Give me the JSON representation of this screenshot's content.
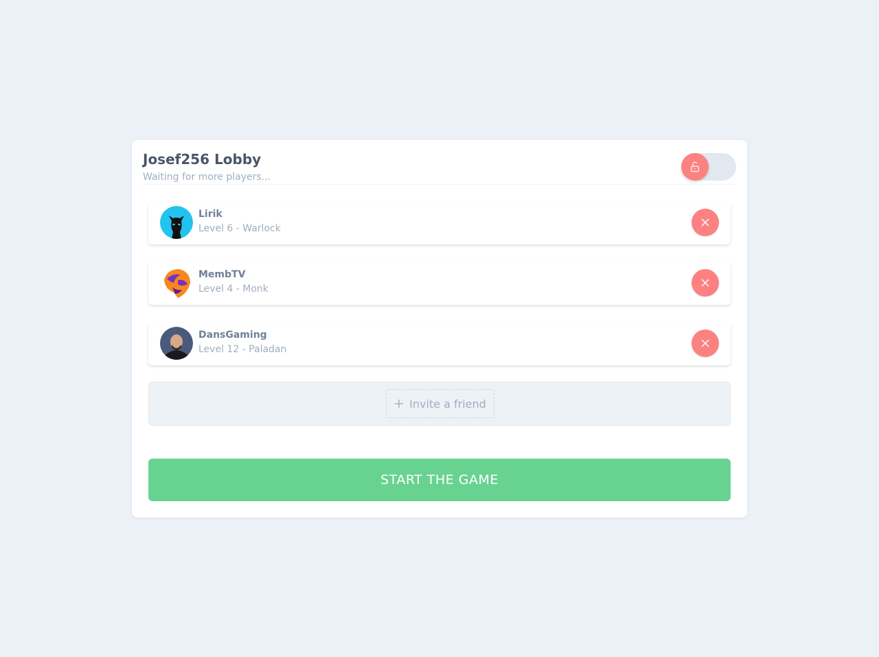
{
  "lobby": {
    "title": "Josef256 Lobby",
    "subtitle": "Waiting for more players...",
    "lock_icon": "unlock-icon",
    "locked": false
  },
  "players": [
    {
      "name": "Lirik",
      "meta": "Level 6 - Warlock",
      "avatar": "panther-avatar"
    },
    {
      "name": "MembTV",
      "meta": "Level 4 - Monk",
      "avatar": "mask-avatar"
    },
    {
      "name": "DansGaming",
      "meta": "Level 12 - Paladan",
      "avatar": "photo-avatar"
    }
  ],
  "invite": {
    "label": "Invite a friend",
    "icon": "plus-icon"
  },
  "start": {
    "label": "START THE GAME"
  },
  "colors": {
    "accent_red": "#fc8181",
    "accent_green": "#68d391",
    "background": "#ecf1f8"
  }
}
